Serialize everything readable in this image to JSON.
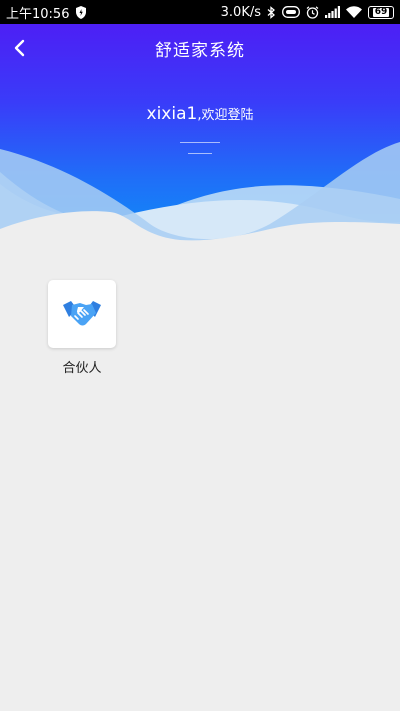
{
  "status_bar": {
    "time": "上午10:56",
    "network_speed": "3.0K/s",
    "battery": "69",
    "icons": [
      "shield-icon",
      "hd-voice-icon",
      "bluetooth-icon",
      "alarm-icon",
      "signal-icon",
      "wifi-icon",
      "battery-icon"
    ]
  },
  "header": {
    "title": "舒适家系统",
    "back_icon": "chevron-left-icon",
    "username": "xixia1",
    "welcome_text": ",欢迎登陆",
    "colors": {
      "gradient_top": "#4d1ff5",
      "gradient_bottom": "#0e8ff6"
    }
  },
  "apps": [
    {
      "label": "合伙人",
      "icon": "handshake-icon",
      "icon_color": "#3a8ef0"
    }
  ],
  "colors": {
    "background": "#eeeeee"
  }
}
